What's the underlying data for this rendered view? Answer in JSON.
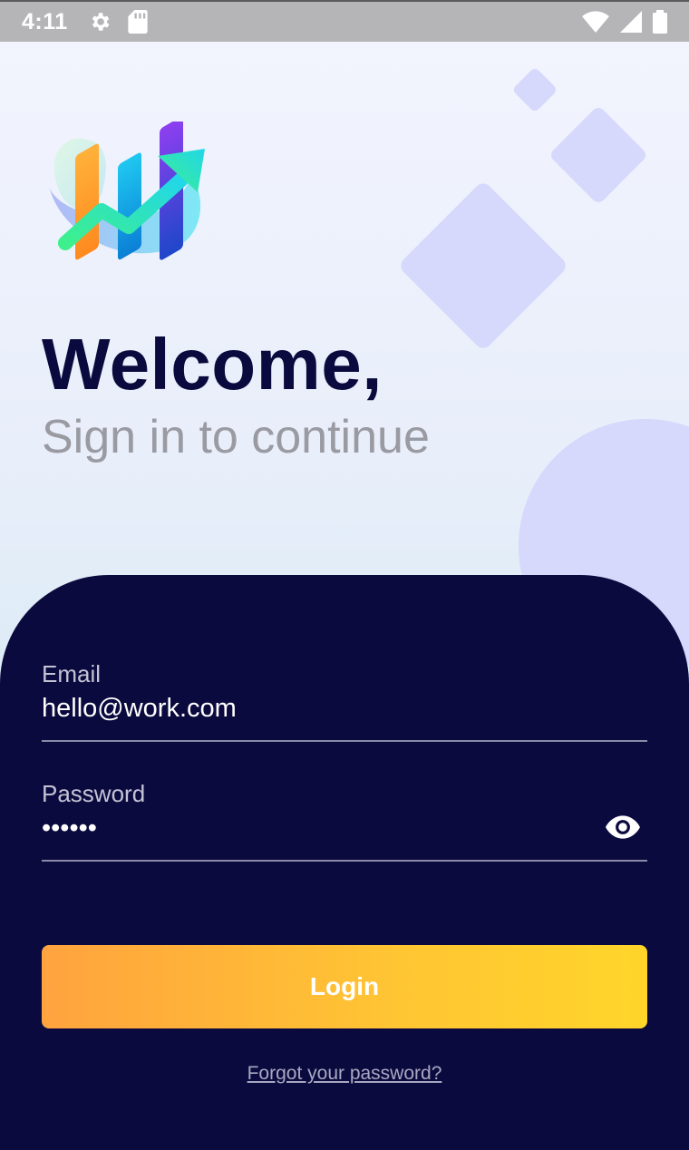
{
  "status_bar": {
    "time": "4:11",
    "left_icons": [
      "gear-icon",
      "sd-card-icon"
    ],
    "right_icons": [
      "wifi-icon",
      "signal-icon",
      "battery-icon"
    ]
  },
  "header": {
    "title": "Welcome,",
    "subtitle": "Sign in to continue"
  },
  "form": {
    "email": {
      "label": "Email",
      "value": "hello@work.com"
    },
    "password": {
      "label": "Password",
      "value": "••••••",
      "toggle_icon": "eye-icon"
    },
    "login_label": "Login",
    "forgot_label": "Forgot your password?"
  },
  "colors": {
    "panel": "#0b0a3e",
    "accent_start": "#ffa33e",
    "accent_end": "#ffd52a",
    "decoration": "#d6d8fc"
  }
}
